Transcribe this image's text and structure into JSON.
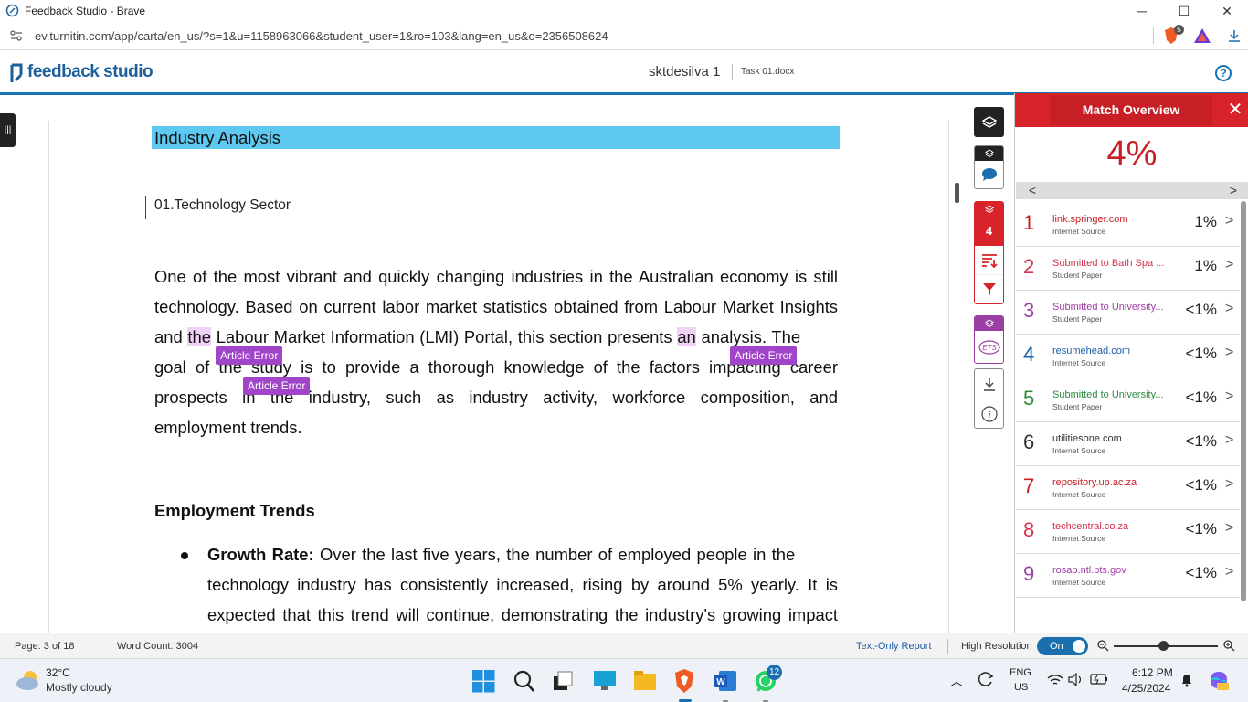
{
  "window": {
    "title": "Feedback Studio - Brave",
    "minimize": "─",
    "maximize": "☐",
    "close": "✕"
  },
  "browser": {
    "url": "ev.turnitin.com/app/carta/en_us/?s=1&u=1158963066&student_user=1&ro=103&lang=en_us&o=2356508624",
    "shield_count": "5"
  },
  "header": {
    "logo": "feedback studio",
    "student": "sktdesilva 1",
    "task": "Task 01.docx",
    "help": "?"
  },
  "document": {
    "heading": "Industry Analysis",
    "section": "01.Technology Sector",
    "p1_line1": "One of the most vibrant and quickly changing industries in the Australian economy is still",
    "p1_line2": "technology. Based on current labor market statistics obtained from Labour Market Insights",
    "p1_line3a": "and ",
    "p1_line3_hl1": "the",
    "p1_line3b": " Labour Market Information (LMI) Portal, this section presents ",
    "p1_line3_hl2": "an",
    "p1_line3c": " analysis. The",
    "p1_line4": "goal of the study is to provide a thorough knowledge of the factors impacting career",
    "p1_line5": "prospects in the industry, such as industry activity, workforce composition, and",
    "p1_line6": "employment trends.",
    "subheading": "Employment Trends",
    "bullet_bold": "Growth Rate:",
    "bullet_line1": " Over the last five years, the number of employed people in the",
    "bullet_line2": "technology industry has consistently increased, rising by around 5% yearly. It is",
    "bullet_line3": "expected that this trend will continue, demonstrating the industry's growing impact",
    "error_tags": [
      "Article Error",
      "Article Error",
      "Article Error"
    ]
  },
  "toolbar": {
    "match_count": "4"
  },
  "panel": {
    "title": "Match Overview",
    "overall": "4%",
    "matches": [
      {
        "num": "1",
        "name": "link.springer.com",
        "type": "Internet Source",
        "pct": "1%",
        "color": "#c81e26"
      },
      {
        "num": "2",
        "name": "Submitted to Bath Spa ...",
        "type": "Student Paper",
        "pct": "1%",
        "color": "#d6314e"
      },
      {
        "num": "3",
        "name": "Submitted to University...",
        "type": "Student Paper",
        "pct": "<1%",
        "color": "#9c3fa5"
      },
      {
        "num": "4",
        "name": "resumehead.com",
        "type": "Internet Source",
        "pct": "<1%",
        "color": "#1c5fa8"
      },
      {
        "num": "5",
        "name": "Submitted to University...",
        "type": "Student Paper",
        "pct": "<1%",
        "color": "#2e8b3d"
      },
      {
        "num": "6",
        "name": "utilitiesone.com",
        "type": "Internet Source",
        "pct": "<1%",
        "color": "#333333"
      },
      {
        "num": "7",
        "name": "repository.up.ac.za",
        "type": "Internet Source",
        "pct": "<1%",
        "color": "#c81e26"
      },
      {
        "num": "8",
        "name": "techcentral.co.za",
        "type": "Internet Source",
        "pct": "<1%",
        "color": "#d6314e"
      },
      {
        "num": "9",
        "name": "rosap.ntl.bts.gov",
        "type": "Internet Source",
        "pct": "<1%",
        "color": "#9c3fa5"
      }
    ]
  },
  "status": {
    "page": "Page: 3 of 18",
    "words": "Word Count: 3004",
    "text_only": "Text-Only Report",
    "high_res": "High Resolution",
    "toggle": "On"
  },
  "taskbar": {
    "temp": "32°C",
    "weather": "Mostly cloudy",
    "lang1": "ENG",
    "lang2": "US",
    "time": "6:12 PM",
    "date": "4/25/2024",
    "whatsapp_badge": "12"
  }
}
